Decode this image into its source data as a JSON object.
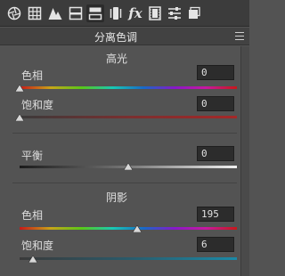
{
  "toolbar": {
    "tools": [
      {
        "icon": "aperture-icon"
      },
      {
        "icon": "grid-icon"
      },
      {
        "icon": "mountain-icon"
      },
      {
        "icon": "tone-curve-icon"
      },
      {
        "icon": "split-toning-icon",
        "active": true
      },
      {
        "icon": "lens-icon"
      },
      {
        "icon": "fx-icon",
        "label": "fx"
      },
      {
        "icon": "film-strip-icon"
      },
      {
        "icon": "sliders-icon"
      },
      {
        "icon": "presets-icon"
      }
    ]
  },
  "panel": {
    "title": "分离色调",
    "highlights": {
      "title": "高光",
      "hue": {
        "label": "色相",
        "value": "0",
        "position": 0
      },
      "saturation": {
        "label": "饱和度",
        "value": "0",
        "position": 0
      }
    },
    "balance": {
      "label": "平衡",
      "value": "0",
      "position": 0.5
    },
    "shadows": {
      "title": "阴影",
      "hue": {
        "label": "色相",
        "value": "195",
        "position": 0.542
      },
      "saturation": {
        "label": "饱和度",
        "value": "6",
        "position": 0.06
      }
    }
  }
}
